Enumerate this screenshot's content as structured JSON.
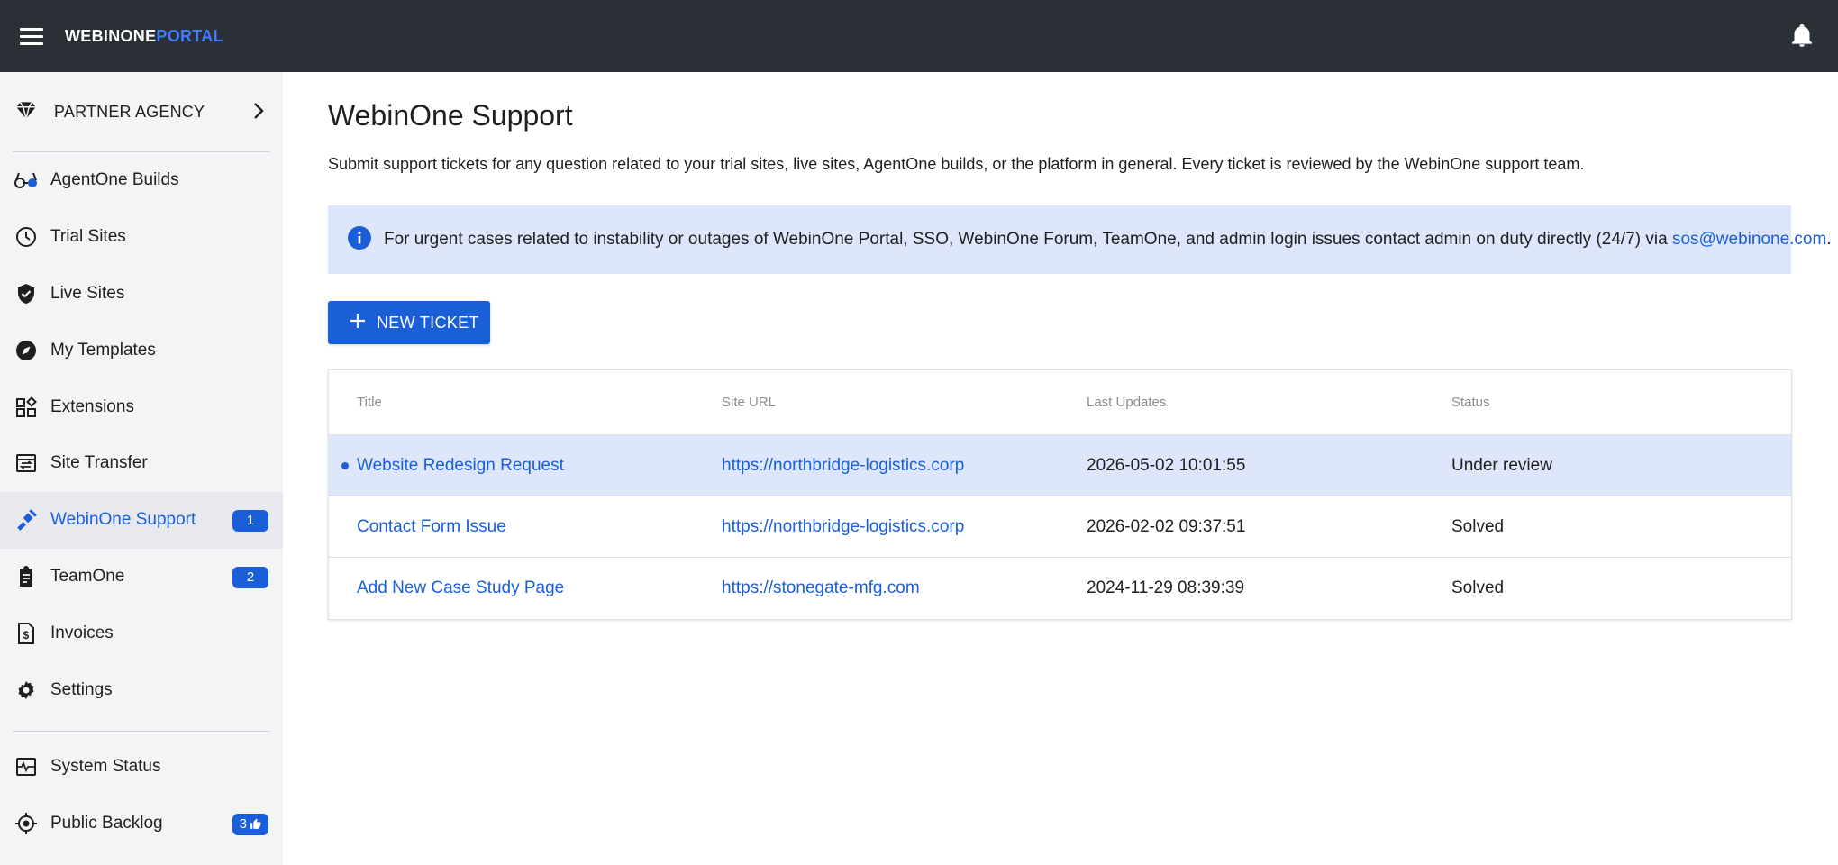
{
  "topbar": {
    "logo_part1": "WEBINONE",
    "logo_part2": "PORTAL"
  },
  "sidebar": {
    "partner_label": "PARTNER AGENCY",
    "items": [
      {
        "label": "AgentOne Builds",
        "icon": "glasses-icon",
        "badge": null
      },
      {
        "label": "Trial Sites",
        "icon": "clock-icon",
        "badge": null
      },
      {
        "label": "Live Sites",
        "icon": "shield-check-icon",
        "badge": null
      },
      {
        "label": "My Templates",
        "icon": "compass-icon",
        "badge": null
      },
      {
        "label": "Extensions",
        "icon": "widgets-icon",
        "badge": null
      },
      {
        "label": "Site Transfer",
        "icon": "transfer-icon",
        "badge": null
      },
      {
        "label": "WebinOne Support",
        "icon": "support-icon",
        "badge": "1",
        "active": true
      },
      {
        "label": "TeamOne",
        "icon": "clipboard-icon",
        "badge": "2"
      },
      {
        "label": "Invoices",
        "icon": "invoice-icon",
        "badge": null
      },
      {
        "label": "Settings",
        "icon": "gear-icon",
        "badge": null
      },
      {
        "label": "System Status",
        "icon": "monitor-heart-icon",
        "badge": null
      },
      {
        "label": "Public Backlog",
        "icon": "target-icon",
        "badge": "3"
      }
    ]
  },
  "main": {
    "title": "WebinOne Support",
    "description": "Submit support tickets for any question related to your trial sites, live sites, AgentOne builds, or the platform in general. Every ticket is reviewed by the WebinOne support team.",
    "info_text": "For urgent cases related to instability or outages of WebinOne Portal, SSO, WebinOne Forum, TeamOne, and admin login issues contact admin on duty directly (24/7) via ",
    "info_email": "sos@webinone.com",
    "info_suffix": ".",
    "new_ticket_label": "NEW TICKET"
  },
  "table": {
    "headers": [
      "Title",
      "Site URL",
      "Last Updates",
      "Status"
    ],
    "rows": [
      {
        "title": "Website Redesign Request",
        "url": "https://northbridge-logistics.corp",
        "updated": "2026-05-02 10:01:55",
        "status": "Under review"
      },
      {
        "title": "Contact Form Issue",
        "url": "https://northbridge-logistics.corp",
        "updated": "2026-02-02 09:37:51",
        "status": "Solved"
      },
      {
        "title": "Add New Case Study Page",
        "url": "https://stonegate-mfg.com",
        "updated": "2024-11-29 08:39:39",
        "status": "Solved"
      }
    ]
  },
  "colors": {
    "topbar": "#2b2f36",
    "accent": "#1a5fd8",
    "info_bg": "#dde6fb",
    "sidebar_bg": "#f3f4f6"
  }
}
